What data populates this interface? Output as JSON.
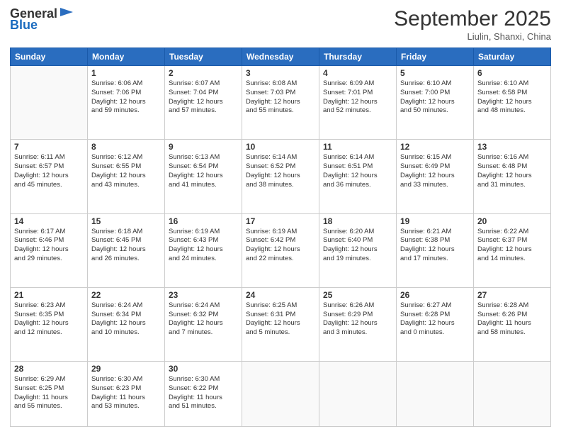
{
  "header": {
    "logo_general": "General",
    "logo_blue": "Blue",
    "month_title": "September 2025",
    "location": "Liulin, Shanxi, China"
  },
  "days_of_week": [
    "Sunday",
    "Monday",
    "Tuesday",
    "Wednesday",
    "Thursday",
    "Friday",
    "Saturday"
  ],
  "weeks": [
    [
      {
        "day": "",
        "info": ""
      },
      {
        "day": "1",
        "info": "Sunrise: 6:06 AM\nSunset: 7:06 PM\nDaylight: 12 hours\nand 59 minutes."
      },
      {
        "day": "2",
        "info": "Sunrise: 6:07 AM\nSunset: 7:04 PM\nDaylight: 12 hours\nand 57 minutes."
      },
      {
        "day": "3",
        "info": "Sunrise: 6:08 AM\nSunset: 7:03 PM\nDaylight: 12 hours\nand 55 minutes."
      },
      {
        "day": "4",
        "info": "Sunrise: 6:09 AM\nSunset: 7:01 PM\nDaylight: 12 hours\nand 52 minutes."
      },
      {
        "day": "5",
        "info": "Sunrise: 6:10 AM\nSunset: 7:00 PM\nDaylight: 12 hours\nand 50 minutes."
      },
      {
        "day": "6",
        "info": "Sunrise: 6:10 AM\nSunset: 6:58 PM\nDaylight: 12 hours\nand 48 minutes."
      }
    ],
    [
      {
        "day": "7",
        "info": "Sunrise: 6:11 AM\nSunset: 6:57 PM\nDaylight: 12 hours\nand 45 minutes."
      },
      {
        "day": "8",
        "info": "Sunrise: 6:12 AM\nSunset: 6:55 PM\nDaylight: 12 hours\nand 43 minutes."
      },
      {
        "day": "9",
        "info": "Sunrise: 6:13 AM\nSunset: 6:54 PM\nDaylight: 12 hours\nand 41 minutes."
      },
      {
        "day": "10",
        "info": "Sunrise: 6:14 AM\nSunset: 6:52 PM\nDaylight: 12 hours\nand 38 minutes."
      },
      {
        "day": "11",
        "info": "Sunrise: 6:14 AM\nSunset: 6:51 PM\nDaylight: 12 hours\nand 36 minutes."
      },
      {
        "day": "12",
        "info": "Sunrise: 6:15 AM\nSunset: 6:49 PM\nDaylight: 12 hours\nand 33 minutes."
      },
      {
        "day": "13",
        "info": "Sunrise: 6:16 AM\nSunset: 6:48 PM\nDaylight: 12 hours\nand 31 minutes."
      }
    ],
    [
      {
        "day": "14",
        "info": "Sunrise: 6:17 AM\nSunset: 6:46 PM\nDaylight: 12 hours\nand 29 minutes."
      },
      {
        "day": "15",
        "info": "Sunrise: 6:18 AM\nSunset: 6:45 PM\nDaylight: 12 hours\nand 26 minutes."
      },
      {
        "day": "16",
        "info": "Sunrise: 6:19 AM\nSunset: 6:43 PM\nDaylight: 12 hours\nand 24 minutes."
      },
      {
        "day": "17",
        "info": "Sunrise: 6:19 AM\nSunset: 6:42 PM\nDaylight: 12 hours\nand 22 minutes."
      },
      {
        "day": "18",
        "info": "Sunrise: 6:20 AM\nSunset: 6:40 PM\nDaylight: 12 hours\nand 19 minutes."
      },
      {
        "day": "19",
        "info": "Sunrise: 6:21 AM\nSunset: 6:38 PM\nDaylight: 12 hours\nand 17 minutes."
      },
      {
        "day": "20",
        "info": "Sunrise: 6:22 AM\nSunset: 6:37 PM\nDaylight: 12 hours\nand 14 minutes."
      }
    ],
    [
      {
        "day": "21",
        "info": "Sunrise: 6:23 AM\nSunset: 6:35 PM\nDaylight: 12 hours\nand 12 minutes."
      },
      {
        "day": "22",
        "info": "Sunrise: 6:24 AM\nSunset: 6:34 PM\nDaylight: 12 hours\nand 10 minutes."
      },
      {
        "day": "23",
        "info": "Sunrise: 6:24 AM\nSunset: 6:32 PM\nDaylight: 12 hours\nand 7 minutes."
      },
      {
        "day": "24",
        "info": "Sunrise: 6:25 AM\nSunset: 6:31 PM\nDaylight: 12 hours\nand 5 minutes."
      },
      {
        "day": "25",
        "info": "Sunrise: 6:26 AM\nSunset: 6:29 PM\nDaylight: 12 hours\nand 3 minutes."
      },
      {
        "day": "26",
        "info": "Sunrise: 6:27 AM\nSunset: 6:28 PM\nDaylight: 12 hours\nand 0 minutes."
      },
      {
        "day": "27",
        "info": "Sunrise: 6:28 AM\nSunset: 6:26 PM\nDaylight: 11 hours\nand 58 minutes."
      }
    ],
    [
      {
        "day": "28",
        "info": "Sunrise: 6:29 AM\nSunset: 6:25 PM\nDaylight: 11 hours\nand 55 minutes."
      },
      {
        "day": "29",
        "info": "Sunrise: 6:30 AM\nSunset: 6:23 PM\nDaylight: 11 hours\nand 53 minutes."
      },
      {
        "day": "30",
        "info": "Sunrise: 6:30 AM\nSunset: 6:22 PM\nDaylight: 11 hours\nand 51 minutes."
      },
      {
        "day": "",
        "info": ""
      },
      {
        "day": "",
        "info": ""
      },
      {
        "day": "",
        "info": ""
      },
      {
        "day": "",
        "info": ""
      }
    ]
  ]
}
